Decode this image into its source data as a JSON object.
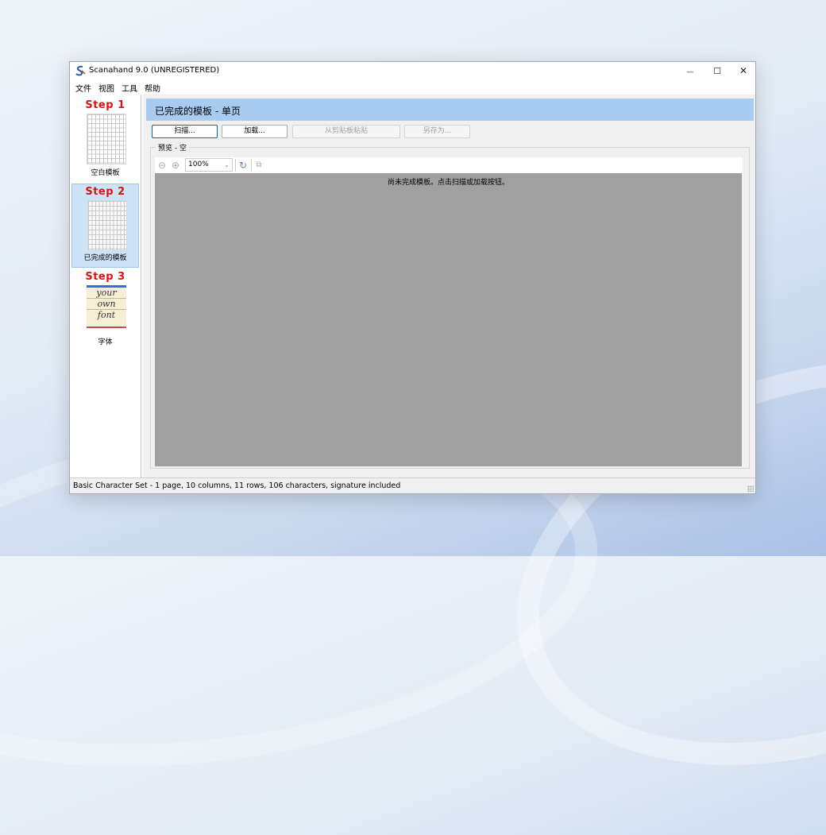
{
  "window": {
    "title": "Scanahand 9.0 (UNREGISTERED)",
    "minimize_glyph": "—",
    "maximize_glyph": "☐",
    "close_glyph": "✕"
  },
  "menu": [
    "文件",
    "视图",
    "工具",
    "帮助"
  ],
  "sidebar": {
    "steps": [
      {
        "step": "Step 1",
        "caption": "空白模板"
      },
      {
        "step": "Step 2",
        "caption": "已完成的模板"
      },
      {
        "step": "Step 3",
        "caption": "字体"
      }
    ],
    "font_sample": [
      "your",
      "own",
      "font"
    ],
    "active_index": 1
  },
  "main": {
    "header": "已完成的模板 - 单页",
    "buttons": {
      "scan": "扫描...",
      "load": "加载...",
      "paste": "从剪贴板粘贴",
      "save_as": "另存为..."
    },
    "preview_group_label": "预览 - 空",
    "zoom": "100%",
    "preview_message": "尚未完成模板。点击扫描或加载按钮。"
  },
  "status": "Basic Character Set - 1 page, 10 columns, 11 rows, 106 characters, signature included",
  "colors": {
    "header_bg": "#a8cbf0",
    "active_step_bg": "#cde3f8",
    "step_label": "#e01010",
    "preview_bg": "#a0a0a0"
  }
}
